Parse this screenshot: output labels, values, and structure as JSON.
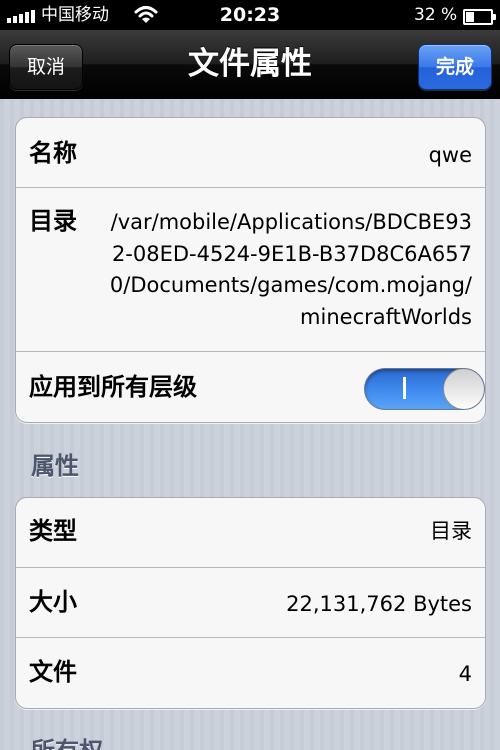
{
  "status_bar": {
    "carrier": "中国移动",
    "time": "20:23",
    "battery_percent": "32 %",
    "battery_level": 0.32,
    "signal_bars": 5,
    "wifi_icon": "wifi-icon"
  },
  "nav": {
    "title": "文件属性",
    "cancel_label": "取消",
    "done_label": "完成"
  },
  "general": {
    "name_label": "名称",
    "name_value": "qwe",
    "dir_label": "目录",
    "dir_value": "/var/mobile/Applications/BDCBE932-08ED-4524-9E1B-B37D8C6A6570/Documents/games/com.mojang/minecraftWorlds",
    "apply_label": "应用到所有层级",
    "apply_on": true
  },
  "attributes": {
    "header": "属性",
    "type_label": "类型",
    "type_value": "目录",
    "size_label": "大小",
    "size_value": "22,131,762 Bytes",
    "files_label": "文件",
    "files_value": "4"
  },
  "ownership": {
    "header": "所有权"
  },
  "colors": {
    "done_button": "#2a6be0",
    "toggle_on": "#3d89ee",
    "section_header": "#4c566c"
  }
}
